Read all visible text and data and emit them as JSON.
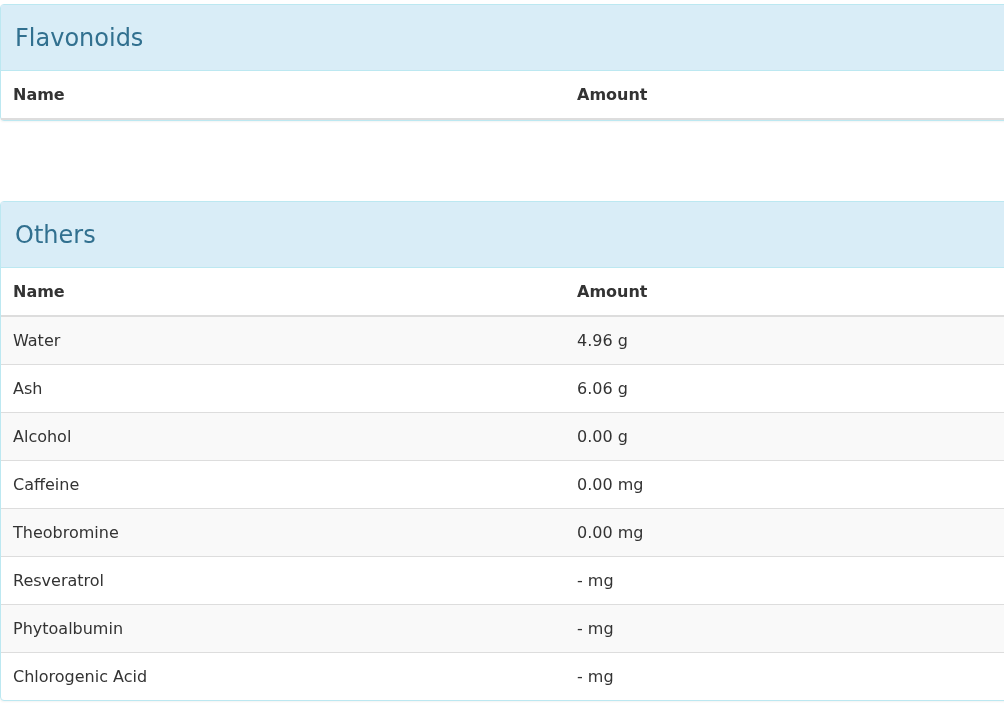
{
  "panels": [
    {
      "title": "Flavonoids",
      "columns": [
        "Name",
        "Amount"
      ]
    },
    {
      "title": "Others",
      "columns": [
        "Name",
        "Amount"
      ],
      "rows": [
        [
          "Water",
          "4.96 g"
        ],
        [
          "Ash",
          "6.06 g"
        ],
        [
          "Alcohol",
          "0.00 g"
        ],
        [
          "Caffeine",
          "0.00 mg"
        ],
        [
          "Theobromine",
          "0.00 mg"
        ],
        [
          "Resveratrol",
          "- mg"
        ],
        [
          "Phytoalbumin",
          "- mg"
        ],
        [
          "Chlorogenic Acid",
          "- mg"
        ]
      ]
    }
  ]
}
